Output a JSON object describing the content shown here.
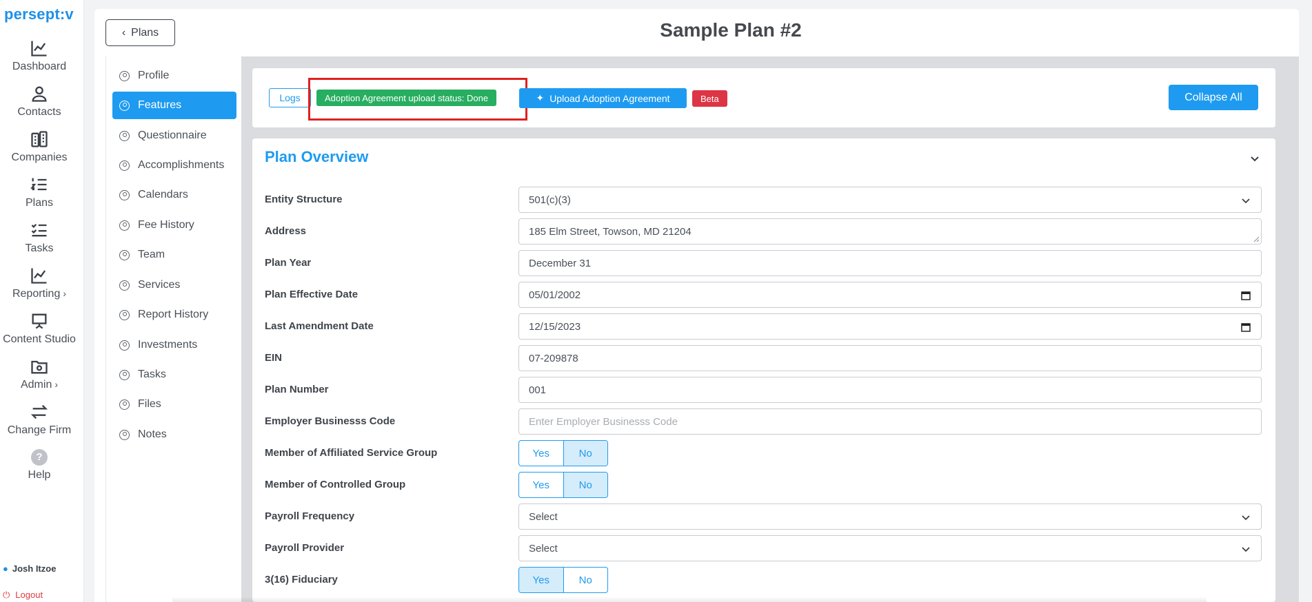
{
  "app": {
    "logo": "persept:v"
  },
  "rail": {
    "items": [
      {
        "label": "Dashboard",
        "icon": "chart-line-icon"
      },
      {
        "label": "Contacts",
        "icon": "user-icon"
      },
      {
        "label": "Companies",
        "icon": "building-icon"
      },
      {
        "label": "Plans",
        "icon": "numbered-list-icon"
      },
      {
        "label": "Tasks",
        "icon": "checklist-icon"
      },
      {
        "label": "Reporting",
        "icon": "chart-line-icon",
        "chevron": "›"
      },
      {
        "label": "Content Studio",
        "icon": "presentation-icon"
      },
      {
        "label": "Admin",
        "icon": "folder-gear-icon",
        "chevron": "›"
      },
      {
        "label": "Change Firm",
        "icon": "swap-arrows-icon"
      },
      {
        "label": "Help",
        "icon": "help-icon",
        "glyph": "?"
      }
    ],
    "user": "Josh Itzoe",
    "logout": "Logout"
  },
  "header": {
    "back_label": "Plans",
    "title": "Sample Plan #2"
  },
  "subnav": {
    "items": [
      {
        "label": "Profile",
        "active": false
      },
      {
        "label": "Features",
        "active": true
      },
      {
        "label": "Questionnaire",
        "active": false
      },
      {
        "label": "Accomplishments",
        "active": false
      },
      {
        "label": "Calendars",
        "active": false
      },
      {
        "label": "Fee History",
        "active": false
      },
      {
        "label": "Team",
        "active": false
      },
      {
        "label": "Services",
        "active": false
      },
      {
        "label": "Report History",
        "active": false
      },
      {
        "label": "Investments",
        "active": false
      },
      {
        "label": "Tasks",
        "active": false
      },
      {
        "label": "Files",
        "active": false
      },
      {
        "label": "Notes",
        "active": false
      }
    ]
  },
  "toolbar": {
    "logs_label": "Logs",
    "status_badge": "Adoption Agreement upload status: Done",
    "upload_label": "Upload Adoption Agreement",
    "beta_label": "Beta",
    "collapse_label": "Collapse All"
  },
  "section": {
    "title": "Plan Overview",
    "fields": {
      "entity_structure": {
        "label": "Entity Structure",
        "value": "501(c)(3)"
      },
      "address": {
        "label": "Address",
        "value": "185 Elm Street, Towson, MD 21204"
      },
      "plan_year": {
        "label": "Plan Year",
        "value": "December 31"
      },
      "effective_date": {
        "label": "Plan Effective Date",
        "value": "05/01/2002"
      },
      "amendment_date": {
        "label": "Last Amendment Date",
        "value": "12/15/2023"
      },
      "ein": {
        "label": "EIN",
        "value": "07-209878"
      },
      "plan_number": {
        "label": "Plan Number",
        "value": "001"
      },
      "business_code": {
        "label": "Employer Businesss Code",
        "placeholder": "Enter Employer Businesss Code"
      },
      "affiliated_group": {
        "label": "Member of Affiliated Service Group",
        "yes": "Yes",
        "no": "No",
        "selected": "No"
      },
      "controlled_group": {
        "label": "Member of Controlled Group",
        "yes": "Yes",
        "no": "No",
        "selected": "No"
      },
      "payroll_frequency": {
        "label": "Payroll Frequency",
        "value": "Select"
      },
      "payroll_provider": {
        "label": "Payroll Provider",
        "value": "Select"
      },
      "fiduciary_316": {
        "label": "3(16) Fiduciary",
        "yes": "Yes",
        "no": "No",
        "selected": "Yes"
      }
    }
  },
  "colors": {
    "accent": "#1e9bf0",
    "success": "#27ae60",
    "danger": "#dc3545",
    "highlight": "#e02020"
  }
}
